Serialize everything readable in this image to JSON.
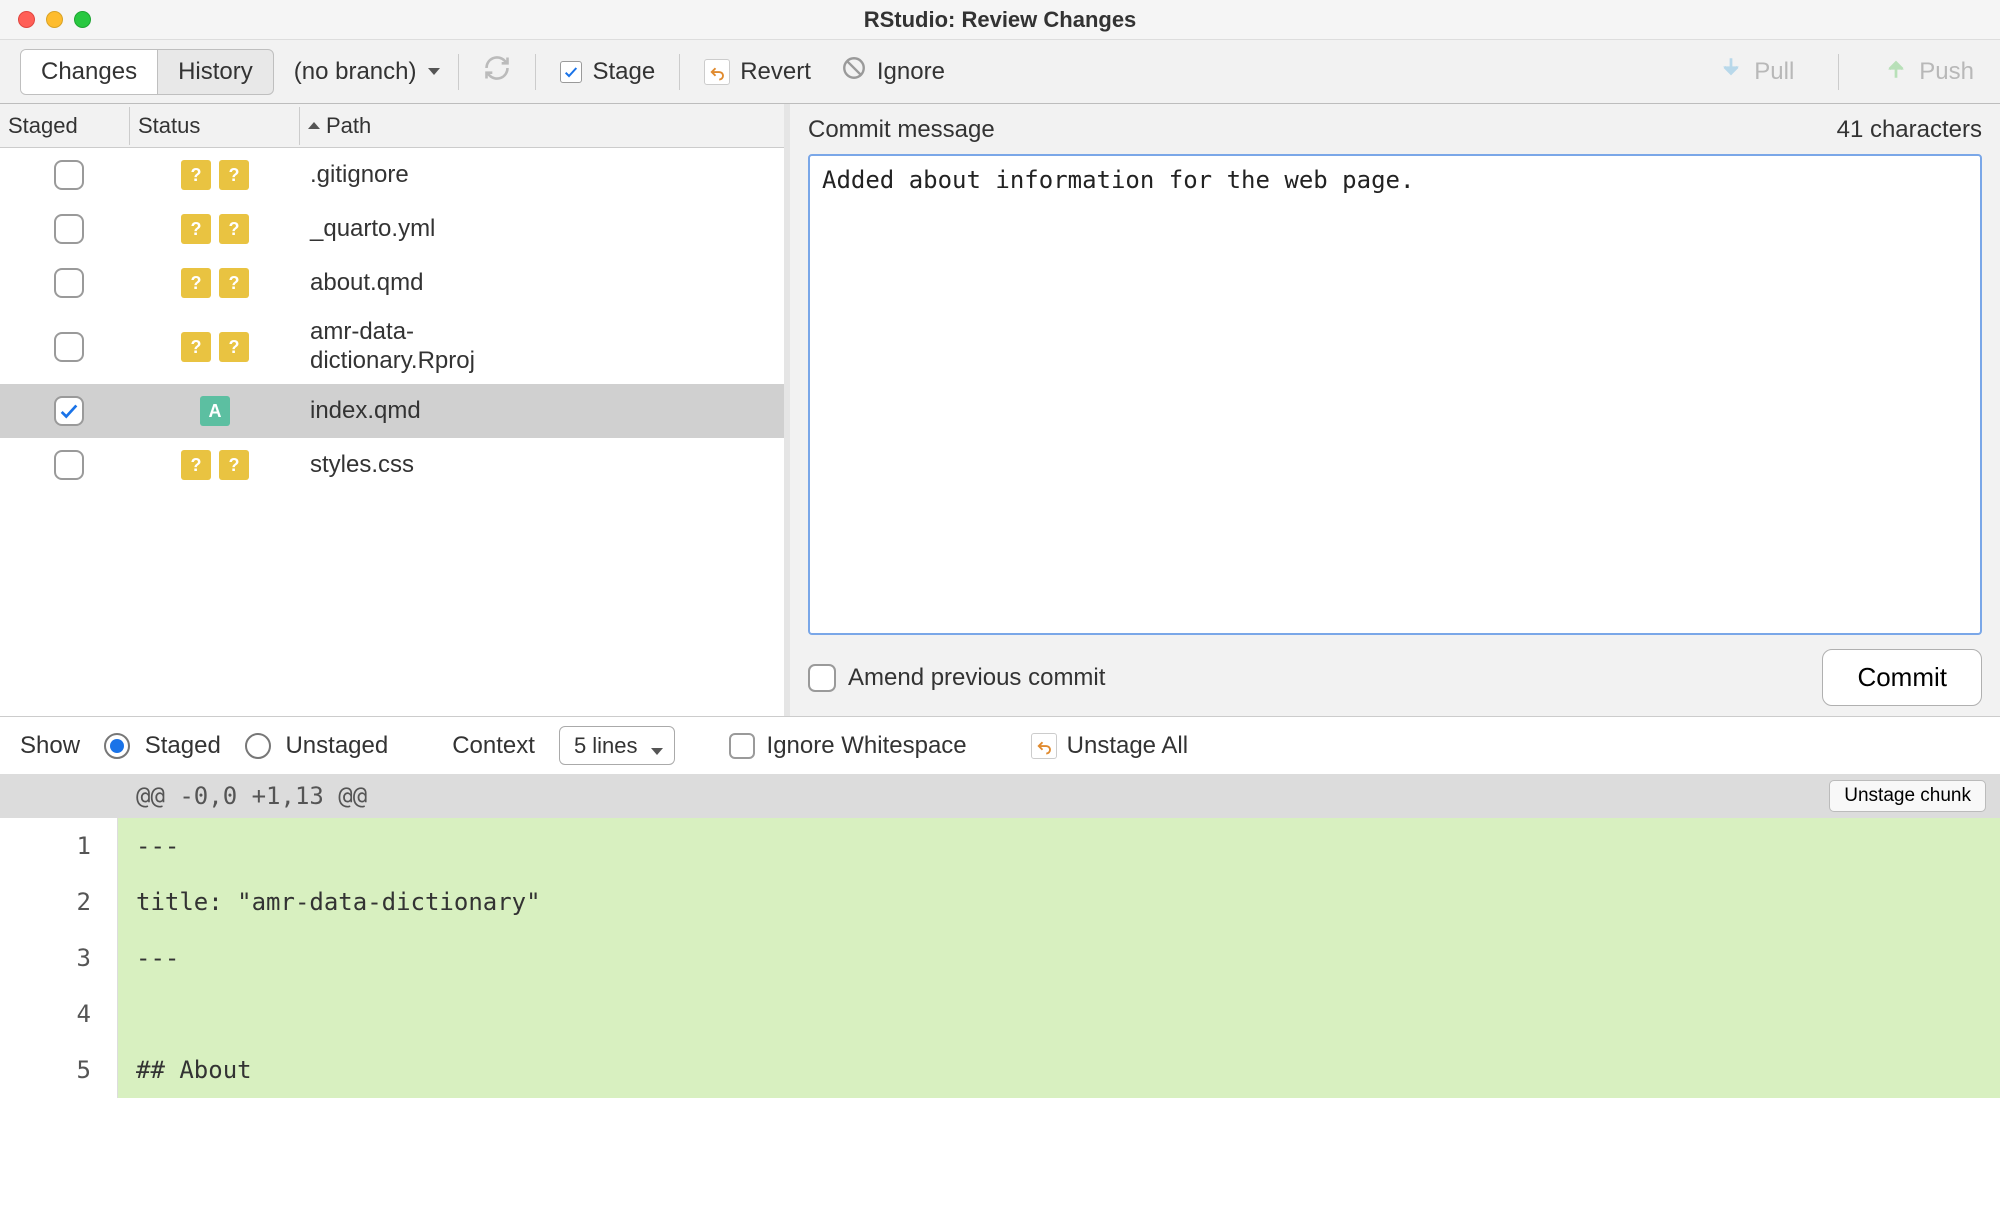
{
  "window": {
    "title": "RStudio: Review Changes"
  },
  "toolbar": {
    "tabs": {
      "changes": "Changes",
      "history": "History",
      "active": "changes"
    },
    "branch": "(no branch)",
    "stage": "Stage",
    "revert": "Revert",
    "ignore": "Ignore",
    "pull": "Pull",
    "push": "Push"
  },
  "files": {
    "headers": {
      "staged": "Staged",
      "status": "Status",
      "path": "Path"
    },
    "rows": [
      {
        "staged": false,
        "status": [
          "?",
          "?"
        ],
        "status_type": "q",
        "path": ".gitignore",
        "selected": false
      },
      {
        "staged": false,
        "status": [
          "?",
          "?"
        ],
        "status_type": "q",
        "path": "_quarto.yml",
        "selected": false
      },
      {
        "staged": false,
        "status": [
          "?",
          "?"
        ],
        "status_type": "q",
        "path": "about.qmd",
        "selected": false
      },
      {
        "staged": false,
        "status": [
          "?",
          "?"
        ],
        "status_type": "q",
        "path": "amr-data-dictionary.Rproj",
        "path_lines": [
          "amr-data-",
          "dictionary.Rproj"
        ],
        "selected": false
      },
      {
        "staged": true,
        "status": [
          "A"
        ],
        "status_type": "a",
        "path": "index.qmd",
        "selected": true
      },
      {
        "staged": false,
        "status": [
          "?",
          "?"
        ],
        "status_type": "q",
        "path": "styles.css",
        "selected": false
      }
    ]
  },
  "commit": {
    "label": "Commit message",
    "char_count": "41 characters",
    "message": "Added about information for the web page.",
    "amend_label": "Amend previous commit",
    "amend_checked": false,
    "button": "Commit"
  },
  "diff_toolbar": {
    "show_label": "Show",
    "staged_label": "Staged",
    "unstaged_label": "Unstaged",
    "selected": "staged",
    "context_label": "Context",
    "context_value": "5 lines",
    "ignore_ws_label": "Ignore Whitespace",
    "ignore_ws_checked": false,
    "unstage_all": "Unstage All"
  },
  "diff": {
    "hunk": "@@ -0,0 +1,13 @@",
    "unstage_chunk": "Unstage chunk",
    "lines": [
      {
        "num": "1",
        "text": "---"
      },
      {
        "num": "2",
        "text": "title: \"amr-data-dictionary\""
      },
      {
        "num": "3",
        "text": "---"
      },
      {
        "num": "4",
        "text": ""
      },
      {
        "num": "5",
        "text": "## About"
      }
    ]
  }
}
